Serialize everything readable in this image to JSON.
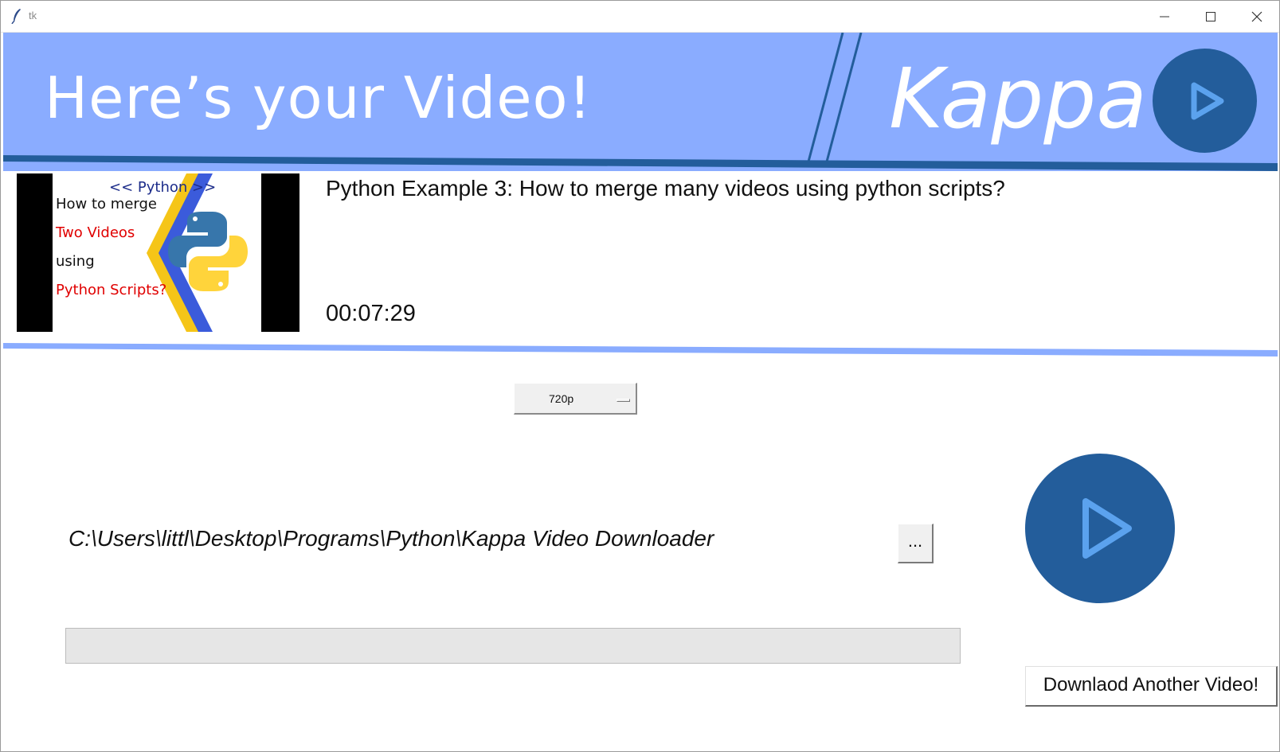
{
  "window": {
    "title": "tk",
    "controls": {
      "minimize_icon": "minimize-icon",
      "maximize_icon": "maximize-icon",
      "close_icon": "close-icon"
    }
  },
  "header": {
    "title": "Here’s your Video!",
    "brand": "Kappa",
    "logo_icon": "play-icon",
    "colors": {
      "banner": "#8aacff",
      "accent": "#235d9b",
      "stripe": "#7ea2f3"
    }
  },
  "video": {
    "thumbnail": {
      "badge": "<< Python >>",
      "line1": "How to merge",
      "line2": "Two Videos",
      "line3": "using",
      "line4": "Python Scripts?"
    },
    "title": "Python Example 3: How to merge many videos using python scripts?",
    "duration": "00:07:29"
  },
  "quality": {
    "selected": "720p"
  },
  "download": {
    "path": "C:\\Users\\littl\\Desktop\\Programs\\Python\\Kappa Video Downloader",
    "browse_label": "...",
    "download_icon": "play-icon",
    "progress": 0,
    "another_label": "Downlaod Another Video!"
  }
}
